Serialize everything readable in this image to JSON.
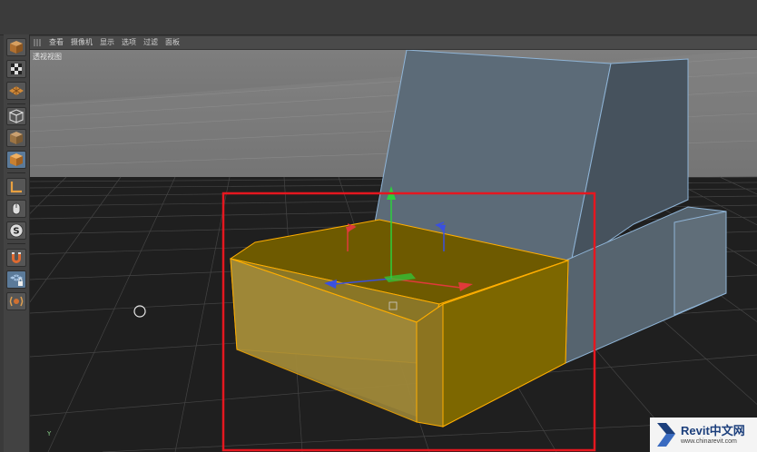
{
  "menu": {
    "items": [
      "查看",
      "摄像机",
      "显示",
      "选项",
      "过滤",
      "面板"
    ]
  },
  "viewport": {
    "label": "透视视图",
    "axis_label": "Y"
  },
  "watermark": {
    "title": "Revit中文网",
    "url": "www.chinarevit.com"
  },
  "colors": {
    "selection_highlight": "#e5171f",
    "object_selected": "#8a7400",
    "edge_highlight": "#ffae00",
    "background_object": "#5c6d7b",
    "grid_floor": "#1e1e1e",
    "sky": "#7c7c7c"
  },
  "toolbar": {
    "icons": [
      "cube-icon",
      "checker-cube-icon",
      "plane-icon",
      "edge-cube-icon",
      "cube-solid-icon",
      "cube-active-icon",
      "axis-l-icon",
      "mouse-icon",
      "snap-s-icon",
      "magnet-icon",
      "lock-grid-icon",
      "gear-spring-icon"
    ]
  }
}
